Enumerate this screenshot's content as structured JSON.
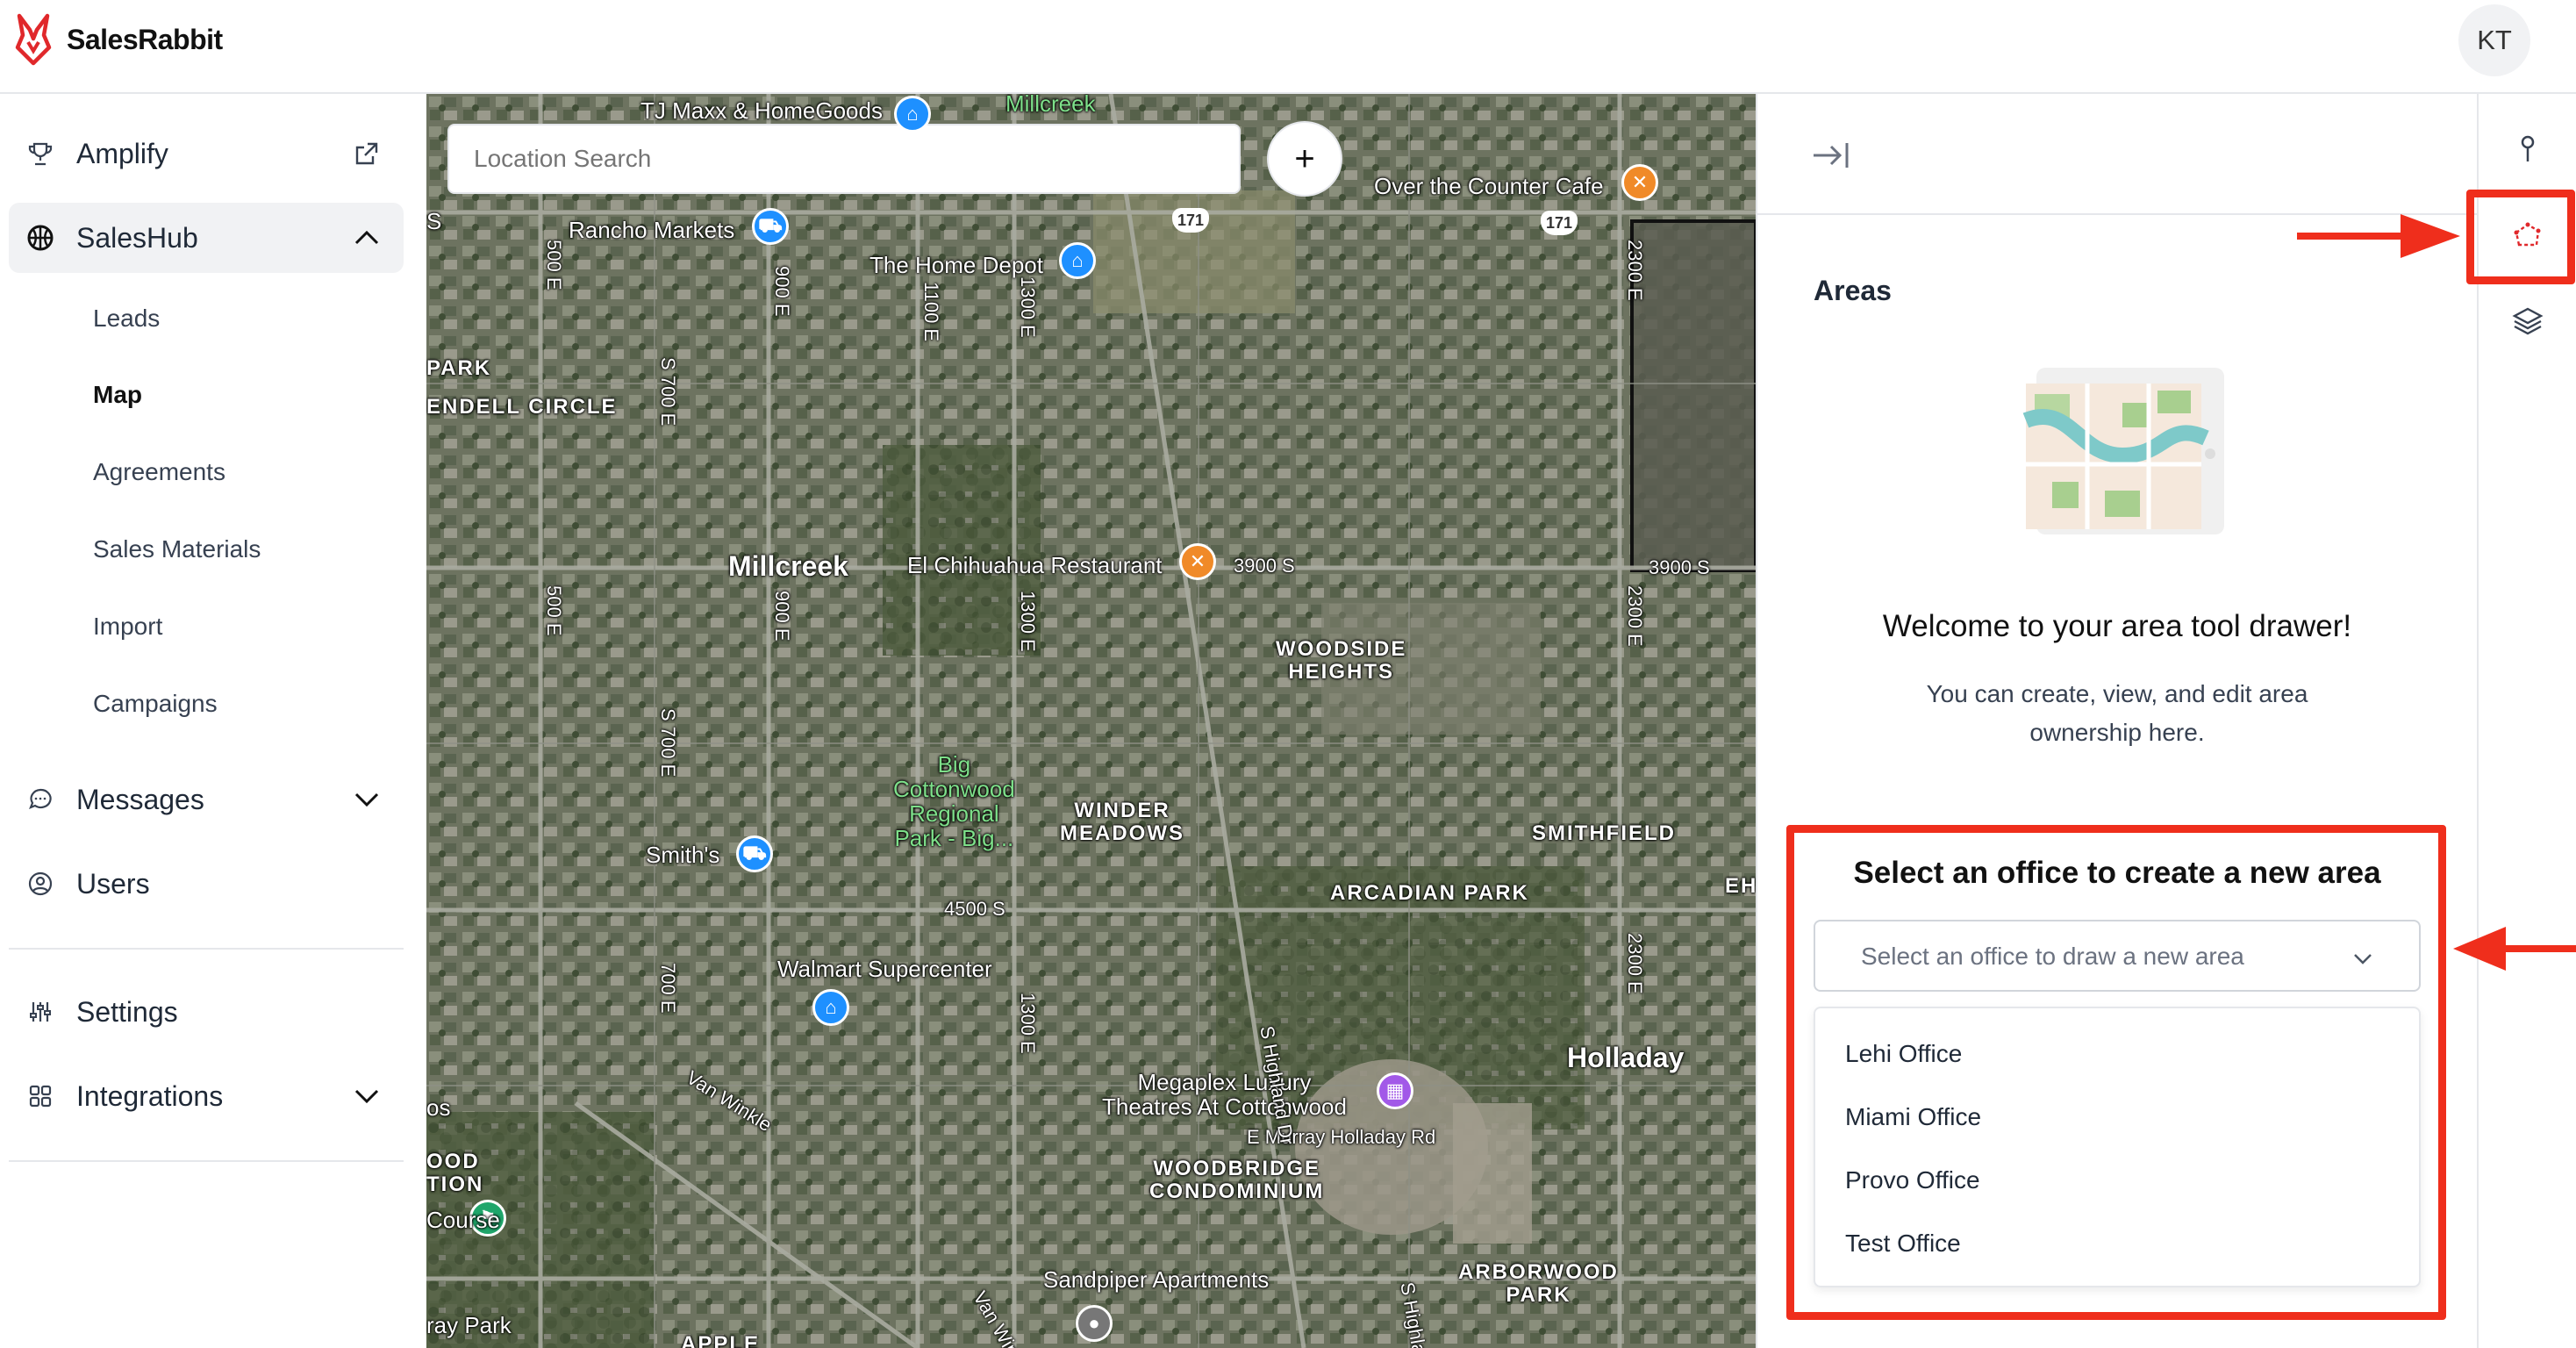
{
  "app": {
    "name": "SalesRabbit",
    "user_initials": "KT"
  },
  "sidebar": {
    "items": [
      {
        "label": "Amplify",
        "icon": "trophy-icon",
        "right_icon": "external-link-icon"
      },
      {
        "label": "SalesHub",
        "icon": "basketball-icon",
        "right_icon": "chevron-up-icon",
        "active": true
      },
      {
        "label": "Messages",
        "icon": "chat-icon",
        "right_icon": "chevron-down-icon"
      },
      {
        "label": "Users",
        "icon": "user-circle-icon"
      },
      {
        "label": "Settings",
        "icon": "sliders-icon"
      },
      {
        "label": "Integrations",
        "icon": "grid-icon",
        "right_icon": "chevron-down-icon"
      }
    ],
    "saleshub_sub": [
      "Leads",
      "Map",
      "Agreements",
      "Sales Materials",
      "Import",
      "Campaigns"
    ],
    "selected_sub": "Map"
  },
  "map": {
    "search_placeholder": "Location Search",
    "add_label": "+",
    "labels": {
      "tjmaxx": "TJ Maxx & HomeGoods",
      "millcreek_top": "Millcreek",
      "rancho": "Rancho Markets",
      "homedepot": "The Home Depot",
      "overcounter": "Over the Counter Cafe",
      "park": "PARK",
      "wendell": "ENDELL CIRCLE",
      "millcreek": "Millcreek",
      "chihuahua": "El Chihuahua Restaurant",
      "s3900": "3900 S",
      "s3900b": "3900 S",
      "woodside": "WOODSIDE\nHEIGHTS",
      "bigcotton": "Big\nCottonwood\nRegional\nPark - Big...",
      "winder": "WINDER\nMEADOWS",
      "smithfield": "SMITHFIELD",
      "smiths": "Smith's",
      "s4500": "4500 S",
      "arcadian": "ARCADIAN PARK",
      "eh": "EH",
      "walmart": "Walmart Supercenter",
      "holladay": "Holladay",
      "megaplex": "Megaplex Luxury\nTheatres At Cottonwood",
      "murray": "E Murray Holladay Rd",
      "vanwinkle": "Van Winkle",
      "woodbridge": "WOODBRIDGE\nCONDOMINIUM",
      "ood": "OOD\nTION",
      "course": "Course",
      "sandpiper": "Sandpiper Apartments",
      "arborwood": "ARBORWOOD\nPARK",
      "rayp": "ray Park",
      "apple": "APPLE",
      "e500a": "500 E",
      "e500b": "500 E",
      "e900a": "900 E",
      "e900b": "900 E",
      "e1100": "1100 E",
      "e1300a": "1300 E",
      "e1300b": "1300 E",
      "e1300c": "1300 E",
      "e2300a": "2300 E",
      "e2300b": "2300 E",
      "e2300c": "2300 E",
      "s700a": "S 700 E",
      "s700b": "S 700 E",
      "e700": "700 E",
      "highland": "S Highland Dr",
      "highland2": "S Highla...",
      "vanwin2": "Van Win...",
      "r171a": "171",
      "r171b": "171",
      "s_left": "S",
      "os": "os"
    }
  },
  "drawer": {
    "title": "Areas",
    "welcome": "Welcome to your area tool drawer!",
    "welcome_sub": "You can create, view, and edit area ownership here.",
    "office_title": "Select an office to create a new area",
    "select_placeholder": "Select an office to draw a new area",
    "offices": [
      "Lehi Office",
      "Miami Office",
      "Provo Office",
      "Test Office"
    ]
  },
  "toolbar": {
    "tools": [
      "pin-icon",
      "area-polygon-icon",
      "layers-icon"
    ],
    "active_tool": "area-polygon-icon"
  },
  "colors": {
    "annotation_red": "#ef2e1c",
    "brand_red": "#e0282b"
  }
}
